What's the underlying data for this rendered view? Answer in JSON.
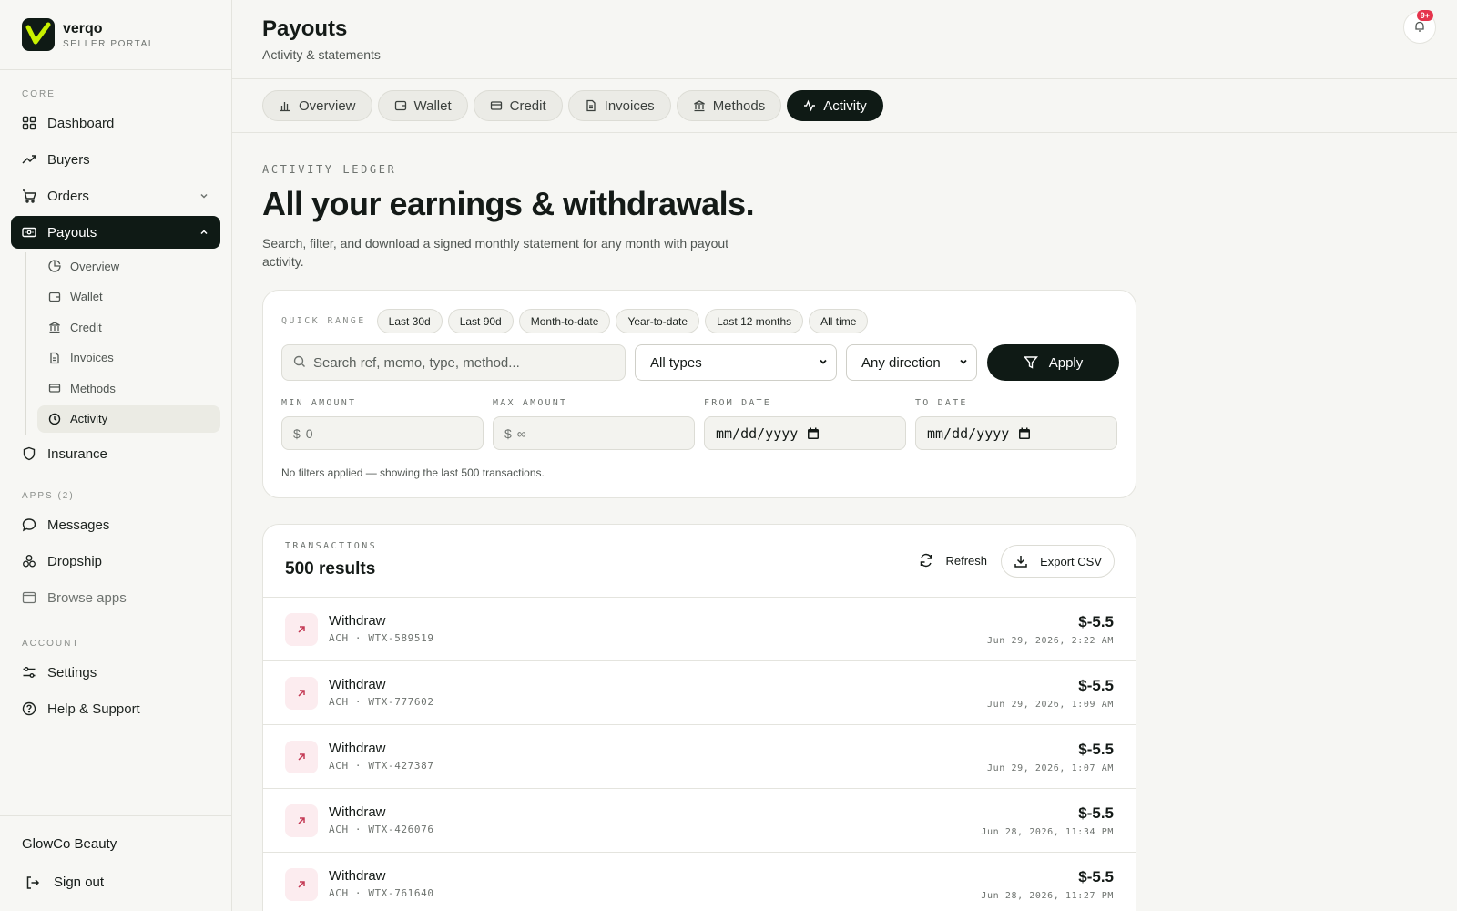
{
  "brand": {
    "name": "verqo",
    "subtitle": "SELLER PORTAL"
  },
  "sidebar": {
    "core_label": "CORE",
    "core_items": [
      {
        "label": "Dashboard",
        "icon": "grid-icon"
      },
      {
        "label": "Buyers",
        "icon": "trend-icon"
      },
      {
        "label": "Orders",
        "icon": "cart-icon"
      },
      {
        "label": "Payouts",
        "icon": "payout-icon"
      }
    ],
    "payout_sub": [
      {
        "label": "Overview",
        "icon": "pie-icon"
      },
      {
        "label": "Wallet",
        "icon": "wallet-icon"
      },
      {
        "label": "Credit",
        "icon": "bank-icon"
      },
      {
        "label": "Invoices",
        "icon": "document-icon"
      },
      {
        "label": "Methods",
        "icon": "card-icon"
      },
      {
        "label": "Activity",
        "icon": "clock-icon"
      }
    ],
    "insurance": "Insurance",
    "apps_label": "APPS (2)",
    "apps_items": [
      {
        "label": "Messages",
        "icon": "chat-icon"
      },
      {
        "label": "Dropship",
        "icon": "boxes-icon"
      },
      {
        "label": "Browse apps",
        "icon": "window-icon"
      }
    ],
    "account_label": "ACCOUNT",
    "account_items": [
      {
        "label": "Settings",
        "icon": "sliders-icon"
      },
      {
        "label": "Help & Support",
        "icon": "help-icon"
      }
    ],
    "company": "GlowCo Beauty",
    "sign_out": "Sign out"
  },
  "header": {
    "title": "Payouts",
    "subtitle": "Activity & statements",
    "notifications": "9+"
  },
  "tabs": [
    {
      "label": "Overview",
      "icon": "bar-chart-icon"
    },
    {
      "label": "Wallet",
      "icon": "wallet-icon"
    },
    {
      "label": "Credit",
      "icon": "card-icon"
    },
    {
      "label": "Invoices",
      "icon": "document-icon"
    },
    {
      "label": "Methods",
      "icon": "bank-icon"
    },
    {
      "label": "Activity",
      "icon": "activity-icon"
    }
  ],
  "ledger": {
    "eyebrow": "ACTIVITY LEDGER",
    "headline": "All your earnings & withdrawals.",
    "description": "Search, filter, and download a signed monthly statement for any month with payout activity."
  },
  "filters": {
    "quick_range_label": "QUICK RANGE",
    "ranges": [
      "Last 30d",
      "Last 90d",
      "Month-to-date",
      "Year-to-date",
      "Last 12 months",
      "All time"
    ],
    "search_placeholder": "Search ref, memo, type, method...",
    "type_select": "All types",
    "direction_select": "Any direction",
    "apply": "Apply",
    "min_label": "MIN AMOUNT",
    "max_label": "MAX AMOUNT",
    "from_label": "FROM DATE",
    "to_label": "TO DATE",
    "currency": "$",
    "min_placeholder": "0",
    "max_placeholder": "∞",
    "date_placeholder": "mm/dd/yyyy",
    "note": "No filters applied — showing the last 500 transactions."
  },
  "transactions": {
    "label": "TRANSACTIONS",
    "count": "500 results",
    "refresh": "Refresh",
    "export": "Export CSV",
    "rows": [
      {
        "title": "Withdraw",
        "meta": "ACH · WTX-589519",
        "amount": "$-5.5",
        "date": "Jun 29, 2026, 2:22 AM"
      },
      {
        "title": "Withdraw",
        "meta": "ACH · WTX-777602",
        "amount": "$-5.5",
        "date": "Jun 29, 2026, 1:09 AM"
      },
      {
        "title": "Withdraw",
        "meta": "ACH · WTX-427387",
        "amount": "$-5.5",
        "date": "Jun 29, 2026, 1:07 AM"
      },
      {
        "title": "Withdraw",
        "meta": "ACH · WTX-426076",
        "amount": "$-5.5",
        "date": "Jun 28, 2026, 11:34 PM"
      },
      {
        "title": "Withdraw",
        "meta": "ACH · WTX-761640",
        "amount": "$-5.5",
        "date": "Jun 28, 2026, 11:27 PM"
      }
    ]
  },
  "colors": {
    "accent": "#0f1a15",
    "brand_mark": "#c8f000",
    "badge": "#e5344c",
    "withdraw_bg": "#fcecef",
    "withdraw_arrow": "#c43a55"
  }
}
